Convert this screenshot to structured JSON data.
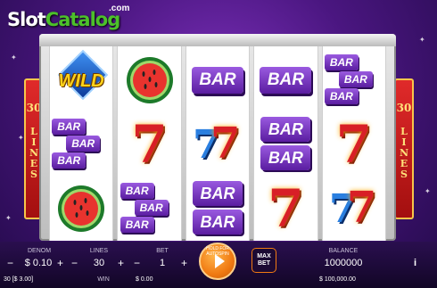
{
  "logo": {
    "slot": "Slot",
    "catalog": "Catalog",
    "com": ".com"
  },
  "side_left": {
    "number": "30",
    "label": "LINES"
  },
  "side_right": {
    "number": "30",
    "label": "LINES"
  },
  "reels": [
    [
      {
        "symbol": "wild-icon",
        "text": "WILD"
      },
      {
        "symbol": "triple-bar-icon",
        "text": "BAR"
      },
      {
        "symbol": "watermelon-icon",
        "text": ""
      }
    ],
    [
      {
        "symbol": "watermelon-icon",
        "text": ""
      },
      {
        "symbol": "red-seven-icon",
        "text": "7"
      },
      {
        "symbol": "triple-bar-icon",
        "text": "BAR"
      }
    ],
    [
      {
        "symbol": "single-bar-icon",
        "text": "BAR"
      },
      {
        "symbol": "blue-red-seven-icon",
        "text": "7"
      },
      {
        "symbol": "double-bar-icon",
        "text": "BAR"
      }
    ],
    [
      {
        "symbol": "single-bar-icon",
        "text": "BAR"
      },
      {
        "symbol": "double-bar-icon",
        "text": "BAR"
      },
      {
        "symbol": "red-seven-icon",
        "text": "7"
      }
    ],
    [
      {
        "symbol": "triple-bar-icon",
        "text": "BAR"
      },
      {
        "symbol": "red-seven-icon",
        "text": "7"
      },
      {
        "symbol": "blue-red-seven-icon",
        "text": "7"
      }
    ]
  ],
  "controls": {
    "denom_label": "DENOM",
    "denom_value": "$ 0.10",
    "lines_label": "LINES",
    "lines_value": "30",
    "bet_label": "BET",
    "bet_value": "1",
    "hold_label": "HOLD FOR AUTOSPIN",
    "maxbet_label": "MAX BET",
    "balance_label": "BALANCE",
    "balance_value": "1000000",
    "minus": "−",
    "plus": "+",
    "info": "i"
  },
  "footer": {
    "bet_total": "30 [$ 3.00]",
    "win_label": "WIN",
    "win_value": "$ 0.00",
    "balance_money": "$ 100,000.00"
  },
  "colors": {
    "bar_purple": "#7a3bc8",
    "seven_red": "#d81f26",
    "seven_blue": "#2a7fe0",
    "accent_orange": "#f07a12",
    "panel_red": "#c41a1a"
  }
}
